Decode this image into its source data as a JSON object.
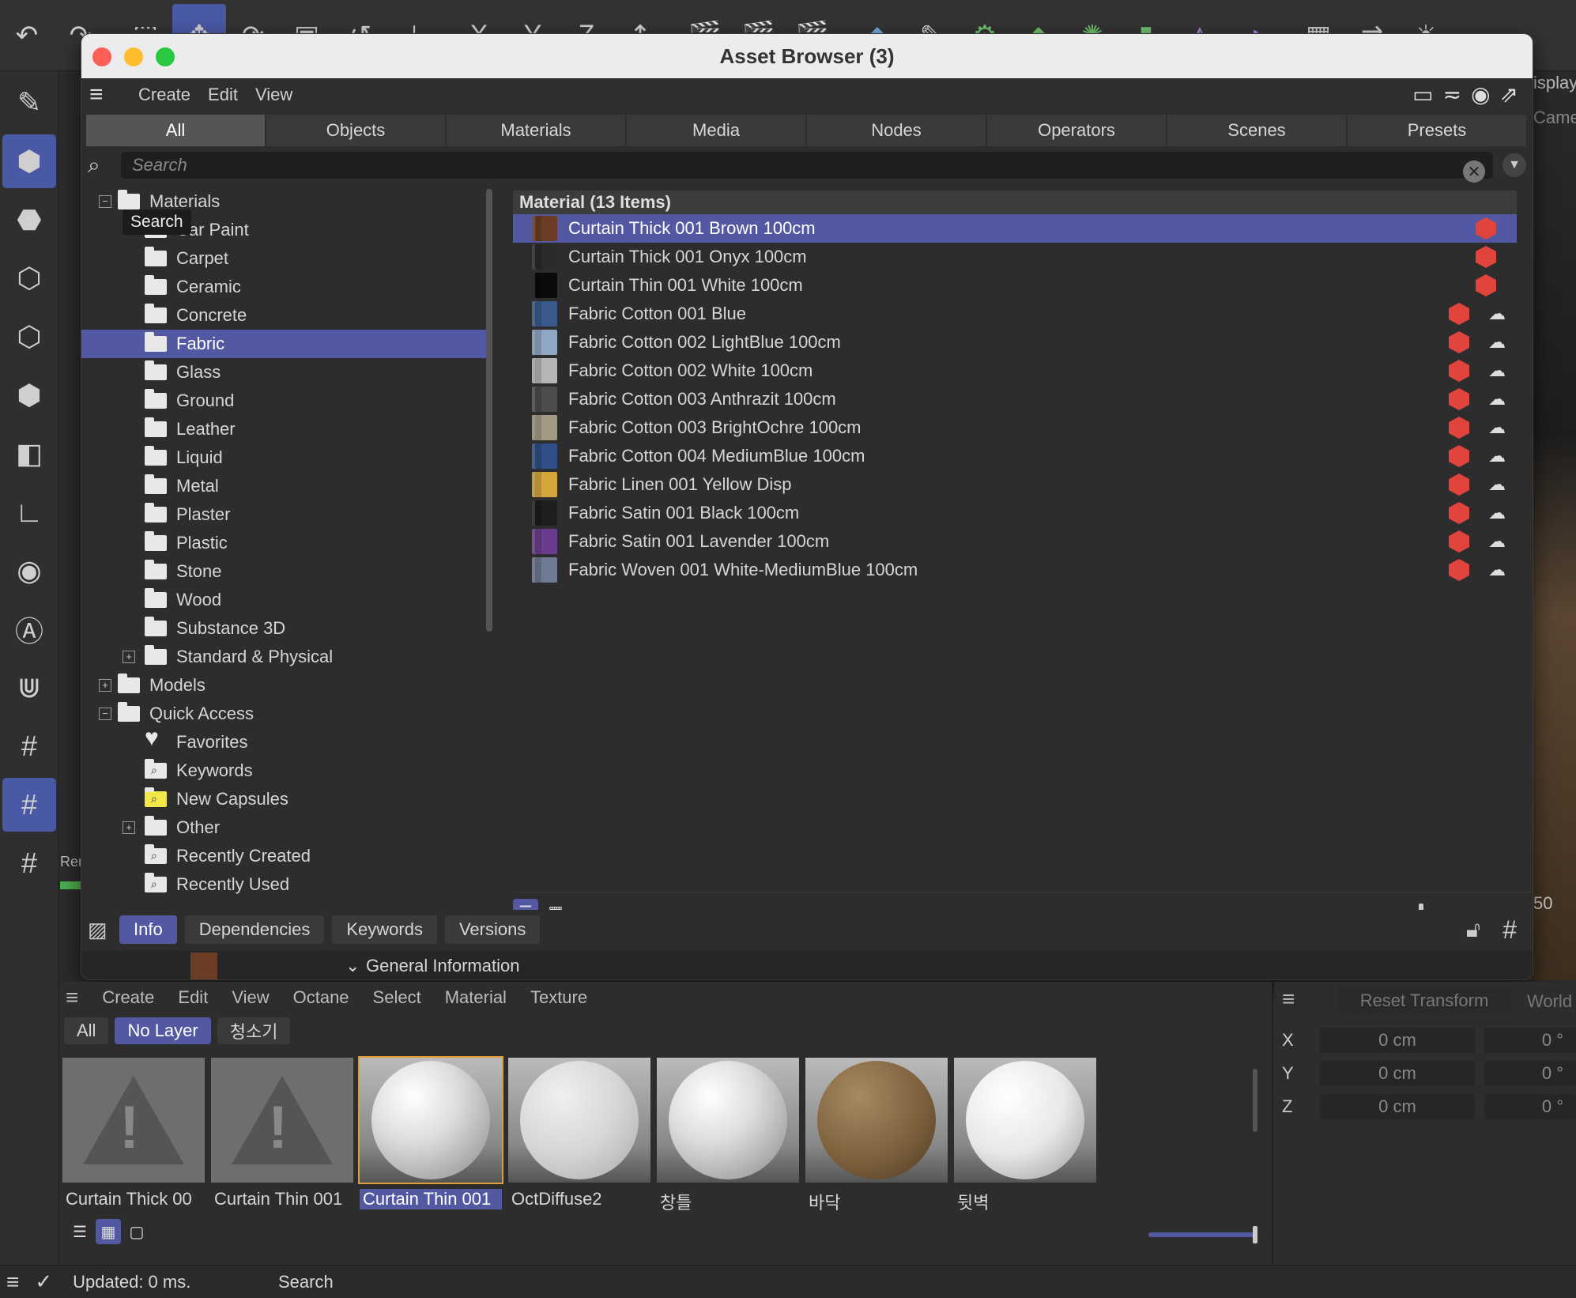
{
  "window": {
    "title": "Asset Browser (3)"
  },
  "menu": {
    "items": [
      "Create",
      "Edit",
      "View"
    ]
  },
  "tabs": [
    "All",
    "Objects",
    "Materials",
    "Media",
    "Nodes",
    "Operators",
    "Scenes",
    "Presets"
  ],
  "search": {
    "placeholder": "Search",
    "tooltip": "Search"
  },
  "tree": {
    "root_label": "Materials",
    "material_folders": [
      "Car Paint",
      "Carpet",
      "Ceramic",
      "Concrete",
      "Fabric",
      "Glass",
      "Ground",
      "Leather",
      "Liquid",
      "Metal",
      "Plaster",
      "Plastic",
      "Stone",
      "Wood",
      "Substance 3D",
      "Standard & Physical"
    ],
    "selected_folder": "Fabric",
    "models_label": "Models",
    "quick_access_label": "Quick Access",
    "quick_access_items": [
      "Favorites",
      "Keywords",
      "New Capsules",
      "Other",
      "Recently Created",
      "Recently Used"
    ]
  },
  "list": {
    "header": "Material (13 Items)",
    "items": [
      {
        "name": "Curtain Thick 001 Brown 100cm",
        "color": "#6b3d24",
        "cloud": false
      },
      {
        "name": "Curtain Thick 001 Onyx 100cm",
        "color": "#2a2a2a",
        "cloud": false
      },
      {
        "name": "Curtain Thin 001 White 100cm",
        "color": "#0a0a0a",
        "cloud": false
      },
      {
        "name": "Fabric Cotton 001 Blue",
        "color": "#3a5a8c",
        "cloud": true
      },
      {
        "name": "Fabric Cotton 002 LightBlue 100cm",
        "color": "#8fa6c4",
        "cloud": true
      },
      {
        "name": "Fabric Cotton 002 White 100cm",
        "color": "#b5b5b5",
        "cloud": true
      },
      {
        "name": "Fabric Cotton 003 Anthrazit 100cm",
        "color": "#4c4c4c",
        "cloud": true
      },
      {
        "name": "Fabric Cotton 003 BrightOchre 100cm",
        "color": "#a39a85",
        "cloud": true
      },
      {
        "name": "Fabric Cotton 004 MediumBlue 100cm",
        "color": "#2f4f86",
        "cloud": true
      },
      {
        "name": "Fabric Linen 001 Yellow Disp",
        "color": "#d4a53a",
        "cloud": true
      },
      {
        "name": "Fabric Satin 001 Black 100cm",
        "color": "#1e1e1e",
        "cloud": true
      },
      {
        "name": "Fabric Satin 001 Lavender 100cm",
        "color": "#6a3c8f",
        "cloud": true
      },
      {
        "name": "Fabric Woven 001 White-MediumBlue 100cm",
        "color": "#6e7b92",
        "cloud": true
      }
    ]
  },
  "info_tabs": [
    "Info",
    "Dependencies",
    "Keywords",
    "Versions"
  ],
  "general_information": "General Information",
  "material_manager": {
    "menu": [
      "Create",
      "Edit",
      "View",
      "Octane",
      "Select",
      "Material",
      "Texture"
    ],
    "layers": [
      "All",
      "No Layer",
      "청소기"
    ],
    "materials": [
      {
        "name": "Curtain Thick 00",
        "kind": "warning"
      },
      {
        "name": "Curtain Thin 001",
        "kind": "warning"
      },
      {
        "name": "Curtain Thin 001",
        "kind": "sphere-white",
        "selected": true
      },
      {
        "name": "OctDiffuse2",
        "kind": "sphere-light"
      },
      {
        "name": "창틀",
        "kind": "sphere-white"
      },
      {
        "name": "바닥",
        "kind": "sphere-wood"
      },
      {
        "name": "뒷벽",
        "kind": "sphere-noise"
      }
    ]
  },
  "coords": {
    "reset_label": "Reset Transform",
    "world_label": "World",
    "rows": [
      {
        "axis": "X",
        "pos": "0 cm",
        "rot": "0 °"
      },
      {
        "axis": "Y",
        "pos": "0 cm",
        "rot": "0 °"
      },
      {
        "axis": "Z",
        "pos": "0 cm",
        "rot": "0 °"
      }
    ]
  },
  "status": {
    "text": "Updated: 0 ms.",
    "search": "Search"
  },
  "background": {
    "display_label": "isplay",
    "camera_label": "Came",
    "render_label": "Ren",
    "frame_label": "50"
  }
}
